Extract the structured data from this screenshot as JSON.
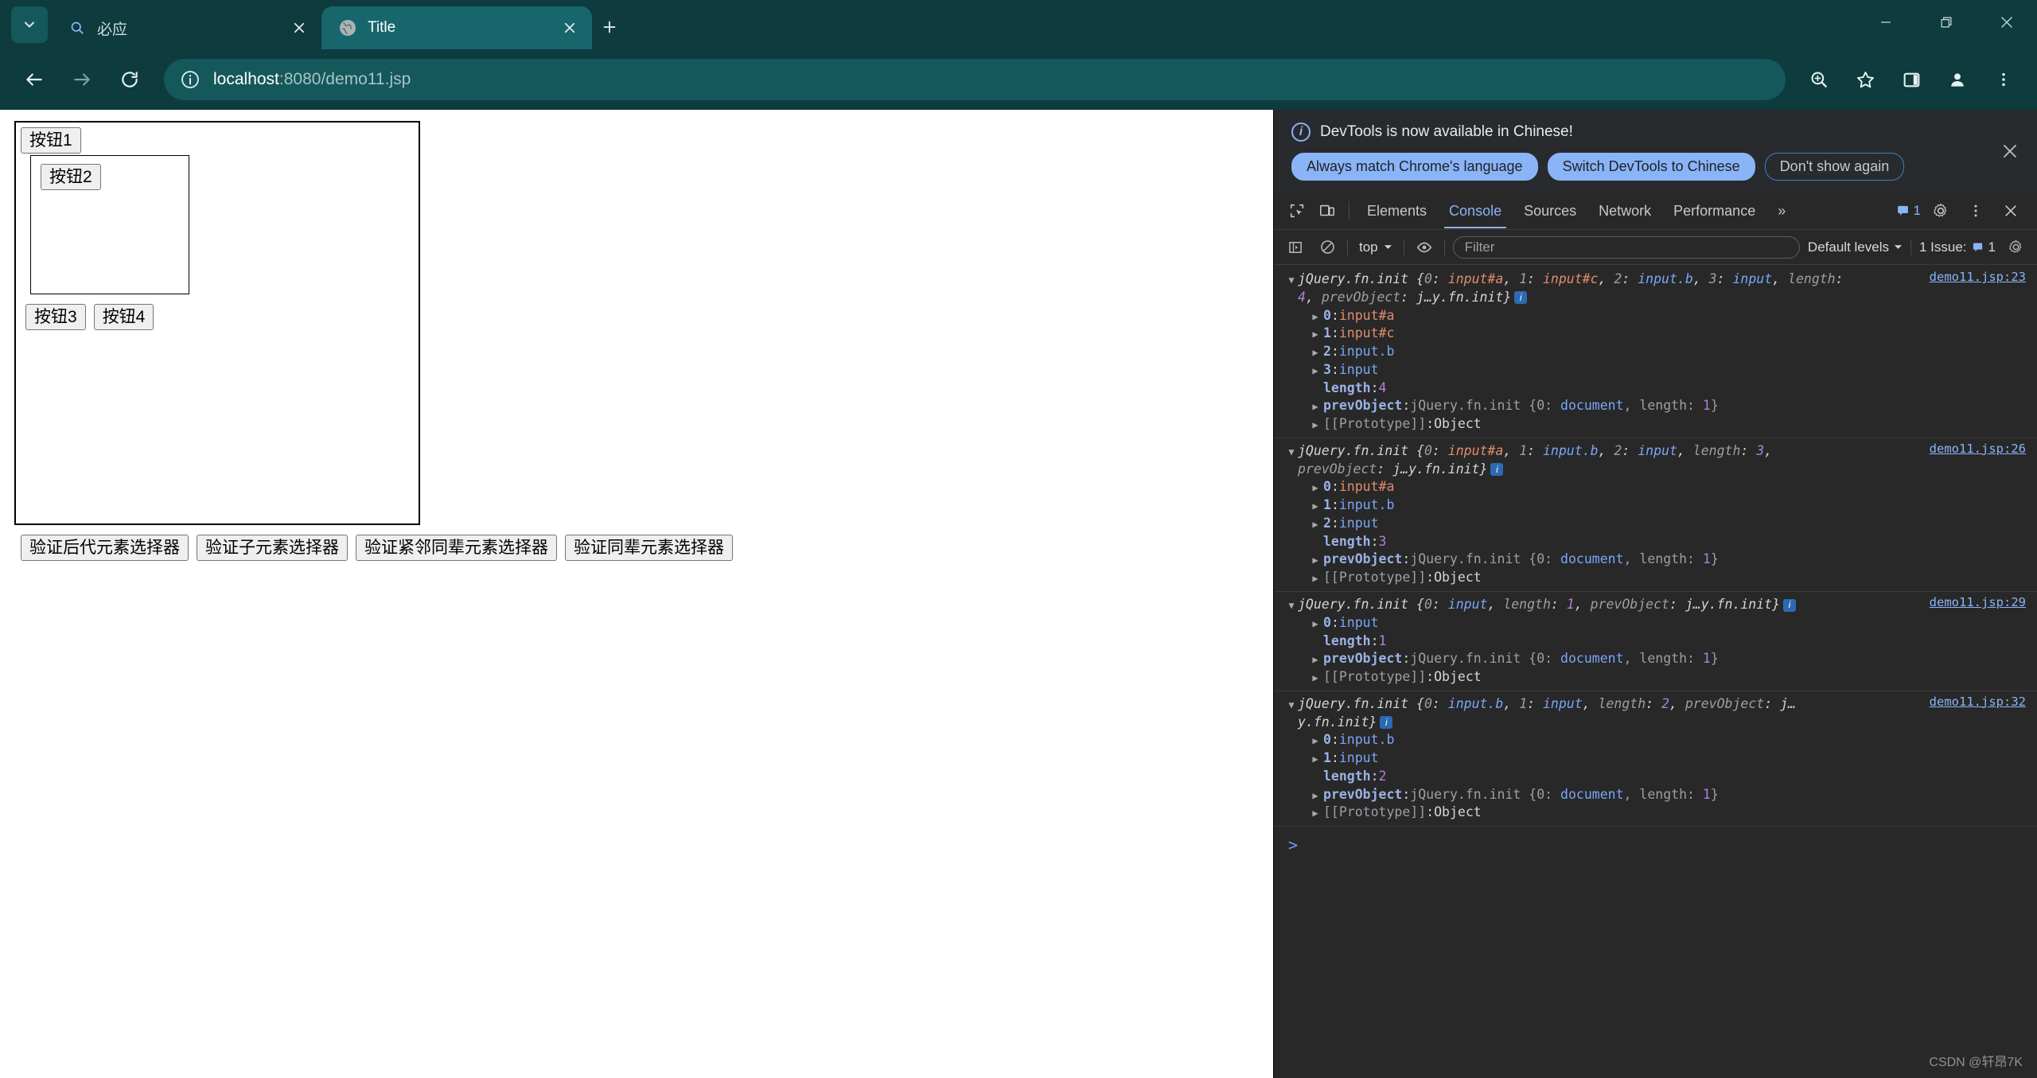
{
  "browser": {
    "tabs": [
      {
        "title": "必应",
        "icon": "search-icon",
        "active": false
      },
      {
        "title": "Title",
        "icon": "globe-favicon",
        "active": true
      }
    ],
    "new_tab_label": "+",
    "window_controls": {
      "minimize": "minimize-icon",
      "restore": "restore-icon",
      "close": "close-icon"
    },
    "toolbar": {
      "back": "back-arrow-icon",
      "forward": "forward-arrow-icon",
      "reload": "reload-icon",
      "site_info": "info-circle-icon",
      "url_host": "localhost",
      "url_path": ":8080/demo11.jsp",
      "url_full": "localhost:8080/demo11.jsp",
      "zoom_icon": "zoom-in-icon",
      "bookmark_icon": "star-icon",
      "side_panel_icon": "side-panel-icon",
      "profile_icon": "profile-avatar-icon",
      "menu_icon": "three-dot-menu-icon"
    }
  },
  "page": {
    "button1": "按钮1",
    "button2": "按钮2",
    "button3": "按钮3",
    "button4": "按钮4",
    "verify_buttons": [
      "验证后代元素选择器",
      "验证子元素选择器",
      "验证紧邻同辈元素选择器",
      "验证同辈元素选择器"
    ]
  },
  "devtools": {
    "banner": {
      "message": "DevTools is now available in Chinese!",
      "primary_1": "Always match Chrome's language",
      "primary_2": "Switch DevTools to Chinese",
      "outline": "Don't show again",
      "close": "×"
    },
    "tabs": [
      {
        "label": "Elements",
        "selected": false
      },
      {
        "label": "Console",
        "selected": true
      },
      {
        "label": "Sources",
        "selected": false
      },
      {
        "label": "Network",
        "selected": false
      },
      {
        "label": "Performance",
        "selected": false
      }
    ],
    "more_tabs": "»",
    "message_count": "1",
    "settings_icon": "gear-icon",
    "more_icon": "three-dot-menu-icon",
    "close_icon": "close-icon",
    "console_bar": {
      "sidebar_icon": "console-sidebar-icon",
      "clear_icon": "clear-console-icon",
      "context": "top",
      "eye_icon": "live-expression-icon",
      "filter_placeholder": "Filter",
      "levels": "Default levels",
      "issues": "1 Issue:",
      "issues_count": "1",
      "settings_icon": "gear-icon"
    },
    "prompt": ">",
    "watermark": "CSDN @轩昂7K",
    "logs": [
      {
        "source": "demo11.jsp:23",
        "summary_prefix": "jQuery.fn.init ",
        "summary_parts": [
          {
            "t": "{",
            "c": "c-obj"
          },
          {
            "t": "0",
            "c": "c-dim"
          },
          {
            "t": ": ",
            "c": "c-obj"
          },
          {
            "t": "input#a",
            "c": "c-node-id"
          },
          {
            "t": ", ",
            "c": "c-obj"
          },
          {
            "t": "1",
            "c": "c-dim"
          },
          {
            "t": ": ",
            "c": "c-obj"
          },
          {
            "t": "input#c",
            "c": "c-node-id"
          },
          {
            "t": ", ",
            "c": "c-obj"
          },
          {
            "t": "2",
            "c": "c-dim"
          },
          {
            "t": ": ",
            "c": "c-obj"
          },
          {
            "t": "input.b",
            "c": "c-node"
          },
          {
            "t": ", ",
            "c": "c-obj"
          },
          {
            "t": "3",
            "c": "c-dim"
          },
          {
            "t": ": ",
            "c": "c-obj"
          },
          {
            "t": "input",
            "c": "c-node"
          },
          {
            "t": ", ",
            "c": "c-obj"
          },
          {
            "t": "length",
            "c": "c-dim"
          },
          {
            "t": ": ",
            "c": "c-obj"
          },
          {
            "t": "4",
            "c": "c-num"
          },
          {
            "t": ", ",
            "c": "c-obj"
          },
          {
            "t": "prevObject",
            "c": "c-dim"
          },
          {
            "t": ": ",
            "c": "c-obj"
          },
          {
            "t": "j…y.fn.init",
            "c": "c-white"
          },
          {
            "t": "}",
            "c": "c-obj"
          }
        ],
        "props": [
          {
            "expandable": true,
            "key": "0",
            "sep": ": ",
            "val": "input#a",
            "valclass": "c-node-id"
          },
          {
            "expandable": true,
            "key": "1",
            "sep": ": ",
            "val": "input#c",
            "valclass": "c-node-id"
          },
          {
            "expandable": true,
            "key": "2",
            "sep": ": ",
            "val": "input.b",
            "valclass": "c-node"
          },
          {
            "expandable": true,
            "key": "3",
            "sep": ": ",
            "val": "input",
            "valclass": "c-node"
          },
          {
            "expandable": false,
            "key": "length",
            "sep": ": ",
            "val": "4",
            "valclass": "c-num"
          },
          {
            "expandable": true,
            "key": "prevObject",
            "sep": ": ",
            "val": "jQuery.fn.init {0: document, length: 1}",
            "valclass": "c-objline"
          },
          {
            "expandable": true,
            "key": "[[Prototype]]",
            "sep": ": ",
            "val": "Object",
            "valclass": "c-white",
            "protokey": true
          }
        ]
      },
      {
        "source": "demo11.jsp:26",
        "summary_prefix": "jQuery.fn.init ",
        "summary_parts": [
          {
            "t": "{",
            "c": "c-obj"
          },
          {
            "t": "0",
            "c": "c-dim"
          },
          {
            "t": ": ",
            "c": "c-obj"
          },
          {
            "t": "input#a",
            "c": "c-node-id"
          },
          {
            "t": ", ",
            "c": "c-obj"
          },
          {
            "t": "1",
            "c": "c-dim"
          },
          {
            "t": ": ",
            "c": "c-obj"
          },
          {
            "t": "input.b",
            "c": "c-node"
          },
          {
            "t": ", ",
            "c": "c-obj"
          },
          {
            "t": "2",
            "c": "c-dim"
          },
          {
            "t": ": ",
            "c": "c-obj"
          },
          {
            "t": "input",
            "c": "c-node"
          },
          {
            "t": ", ",
            "c": "c-obj"
          },
          {
            "t": "length",
            "c": "c-dim"
          },
          {
            "t": ": ",
            "c": "c-obj"
          },
          {
            "t": "3",
            "c": "c-num"
          },
          {
            "t": ", ",
            "c": "c-obj"
          },
          {
            "t": "prevObject",
            "c": "c-dim"
          },
          {
            "t": ": ",
            "c": "c-obj"
          },
          {
            "t": "j…y.fn.init",
            "c": "c-white"
          },
          {
            "t": "}",
            "c": "c-obj"
          }
        ],
        "props": [
          {
            "expandable": true,
            "key": "0",
            "sep": ": ",
            "val": "input#a",
            "valclass": "c-node-id"
          },
          {
            "expandable": true,
            "key": "1",
            "sep": ": ",
            "val": "input.b",
            "valclass": "c-node"
          },
          {
            "expandable": true,
            "key": "2",
            "sep": ": ",
            "val": "input",
            "valclass": "c-node"
          },
          {
            "expandable": false,
            "key": "length",
            "sep": ": ",
            "val": "3",
            "valclass": "c-num"
          },
          {
            "expandable": true,
            "key": "prevObject",
            "sep": ": ",
            "val": "jQuery.fn.init {0: document, length: 1}",
            "valclass": "c-objline"
          },
          {
            "expandable": true,
            "key": "[[Prototype]]",
            "sep": ": ",
            "val": "Object",
            "valclass": "c-white",
            "protokey": true
          }
        ]
      },
      {
        "source": "demo11.jsp:29",
        "summary_prefix": "jQuery.fn.init ",
        "summary_parts": [
          {
            "t": "{",
            "c": "c-obj"
          },
          {
            "t": "0",
            "c": "c-dim"
          },
          {
            "t": ": ",
            "c": "c-obj"
          },
          {
            "t": "input",
            "c": "c-node"
          },
          {
            "t": ", ",
            "c": "c-obj"
          },
          {
            "t": "length",
            "c": "c-dim"
          },
          {
            "t": ": ",
            "c": "c-obj"
          },
          {
            "t": "1",
            "c": "c-num"
          },
          {
            "t": ", ",
            "c": "c-obj"
          },
          {
            "t": "prevObject",
            "c": "c-dim"
          },
          {
            "t": ": ",
            "c": "c-obj"
          },
          {
            "t": "j…y.fn.init",
            "c": "c-white"
          },
          {
            "t": "}",
            "c": "c-obj"
          }
        ],
        "props": [
          {
            "expandable": true,
            "key": "0",
            "sep": ": ",
            "val": "input",
            "valclass": "c-node"
          },
          {
            "expandable": false,
            "key": "length",
            "sep": ": ",
            "val": "1",
            "valclass": "c-num"
          },
          {
            "expandable": true,
            "key": "prevObject",
            "sep": ": ",
            "val": "jQuery.fn.init {0: document, length: 1}",
            "valclass": "c-objline"
          },
          {
            "expandable": true,
            "key": "[[Prototype]]",
            "sep": ": ",
            "val": "Object",
            "valclass": "c-white",
            "protokey": true
          }
        ]
      },
      {
        "source": "demo11.jsp:32",
        "summary_prefix": "jQuery.fn.init ",
        "summary_parts": [
          {
            "t": "{",
            "c": "c-obj"
          },
          {
            "t": "0",
            "c": "c-dim"
          },
          {
            "t": ": ",
            "c": "c-obj"
          },
          {
            "t": "input.b",
            "c": "c-node"
          },
          {
            "t": ", ",
            "c": "c-obj"
          },
          {
            "t": "1",
            "c": "c-dim"
          },
          {
            "t": ": ",
            "c": "c-obj"
          },
          {
            "t": "input",
            "c": "c-node"
          },
          {
            "t": ", ",
            "c": "c-obj"
          },
          {
            "t": "length",
            "c": "c-dim"
          },
          {
            "t": ": ",
            "c": "c-obj"
          },
          {
            "t": "2",
            "c": "c-num"
          },
          {
            "t": ", ",
            "c": "c-obj"
          },
          {
            "t": "prevObject",
            "c": "c-dim"
          },
          {
            "t": ": ",
            "c": "c-obj"
          },
          {
            "t": "j…y.fn.init",
            "c": "c-white"
          },
          {
            "t": "}",
            "c": "c-obj"
          }
        ],
        "props": [
          {
            "expandable": true,
            "key": "0",
            "sep": ": ",
            "val": "input.b",
            "valclass": "c-node"
          },
          {
            "expandable": true,
            "key": "1",
            "sep": ": ",
            "val": "input",
            "valclass": "c-node"
          },
          {
            "expandable": false,
            "key": "length",
            "sep": ": ",
            "val": "2",
            "valclass": "c-num"
          },
          {
            "expandable": true,
            "key": "prevObject",
            "sep": ": ",
            "val": "jQuery.fn.init {0: document, length: 1}",
            "valclass": "c-objline"
          },
          {
            "expandable": true,
            "key": "[[Prototype]]",
            "sep": ": ",
            "val": "Object",
            "valclass": "c-white",
            "protokey": true
          }
        ]
      }
    ]
  },
  "colors": {
    "chrome_bg": "#0d3b3e",
    "tab_active": "#17666b",
    "omnibox": "#14585c",
    "devtools_bg": "#282828",
    "accent_blue": "#8ab4f8"
  }
}
